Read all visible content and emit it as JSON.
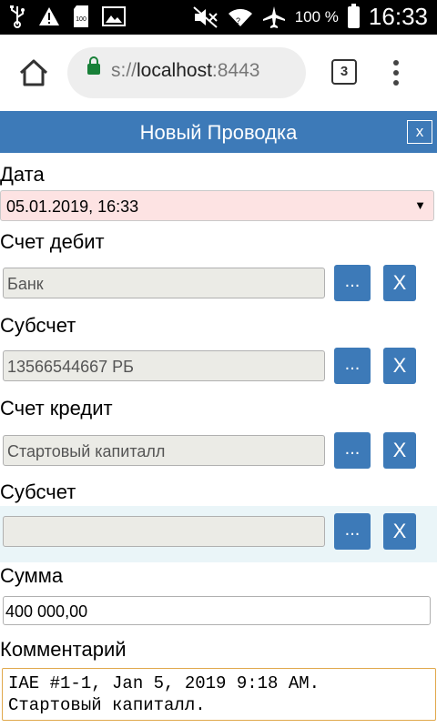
{
  "status_bar": {
    "battery_percent": "100 %",
    "time": "16:33"
  },
  "browser": {
    "url_scheme": "s://",
    "url_host": "localhost",
    "url_port": ":8443",
    "tab_count": "3"
  },
  "dialog": {
    "title": "Новый Проводка",
    "close_label": "x"
  },
  "form": {
    "date": {
      "label": "Дата",
      "value": "05.01.2019, 16:33"
    },
    "debit_account": {
      "label": "Счет дебит",
      "value": "Банк"
    },
    "debit_subaccount": {
      "label": "Субсчет",
      "value": "13566544667 РБ"
    },
    "credit_account": {
      "label": "Счет кредит",
      "value": "Стартовый капиталл"
    },
    "credit_subaccount": {
      "label": "Субсчет",
      "value": ""
    },
    "amount": {
      "label": "Сумма",
      "value": "400 000,00"
    },
    "comment": {
      "label": "Комментарий",
      "value": "IAE #1-1, Jan 5, 2019 9:18 AM.\nСтартовый капиталл."
    },
    "select_button_label": "...",
    "clear_button_label": "X"
  },
  "colors": {
    "accent": "#3d7ab8",
    "date_field_bg": "#fde3e3",
    "highlight_row_bg": "#eaf5f8",
    "comment_border": "#e0a84b"
  }
}
